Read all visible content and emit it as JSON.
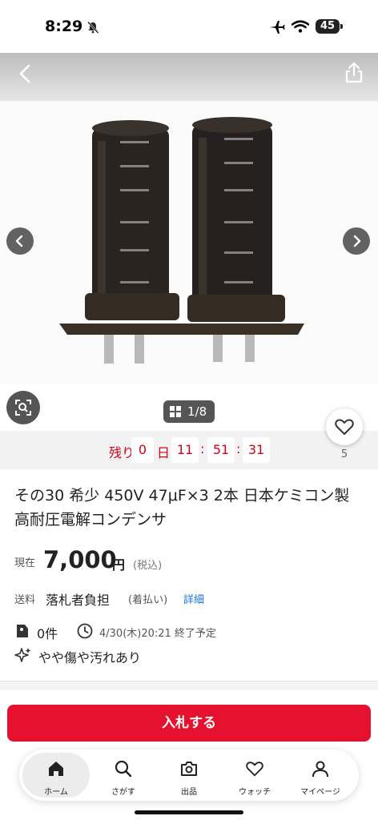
{
  "status": {
    "time": "8:29",
    "battery": "45"
  },
  "gallery": {
    "counter": "1/8",
    "like_count": "5"
  },
  "countdown": {
    "label": "残り",
    "days": "0",
    "unit": "日",
    "hours": "11",
    "minutes": "51",
    "seconds": "31",
    "separator": ":"
  },
  "item": {
    "title": "その30 希少 450V 47μF×3 2本 日本ケミコン製 高耐圧電解コンデンサ",
    "price_label": "現在",
    "price": "7,000",
    "price_unit": "円",
    "tax_note": "(税込)",
    "shipping_label": "送料",
    "shipping_value": "落札者負担",
    "shipping_cod": "(着払い)",
    "shipping_link": "詳細",
    "bids": "0件",
    "end_time": "4/30(木)20:21 終了予定",
    "condition": "やや傷や汚れあり"
  },
  "bid_button": "入札する",
  "nav": {
    "items": [
      {
        "label": "ホーム",
        "icon": "home-icon"
      },
      {
        "label": "さがす",
        "icon": "search-icon"
      },
      {
        "label": "出品",
        "icon": "camera-icon"
      },
      {
        "label": "ウォッチ",
        "icon": "heart-icon"
      },
      {
        "label": "マイページ",
        "icon": "person-icon"
      }
    ]
  },
  "colors": {
    "accent": "#e6102f",
    "countdown": "#d0021b",
    "link": "#1a73e8"
  }
}
